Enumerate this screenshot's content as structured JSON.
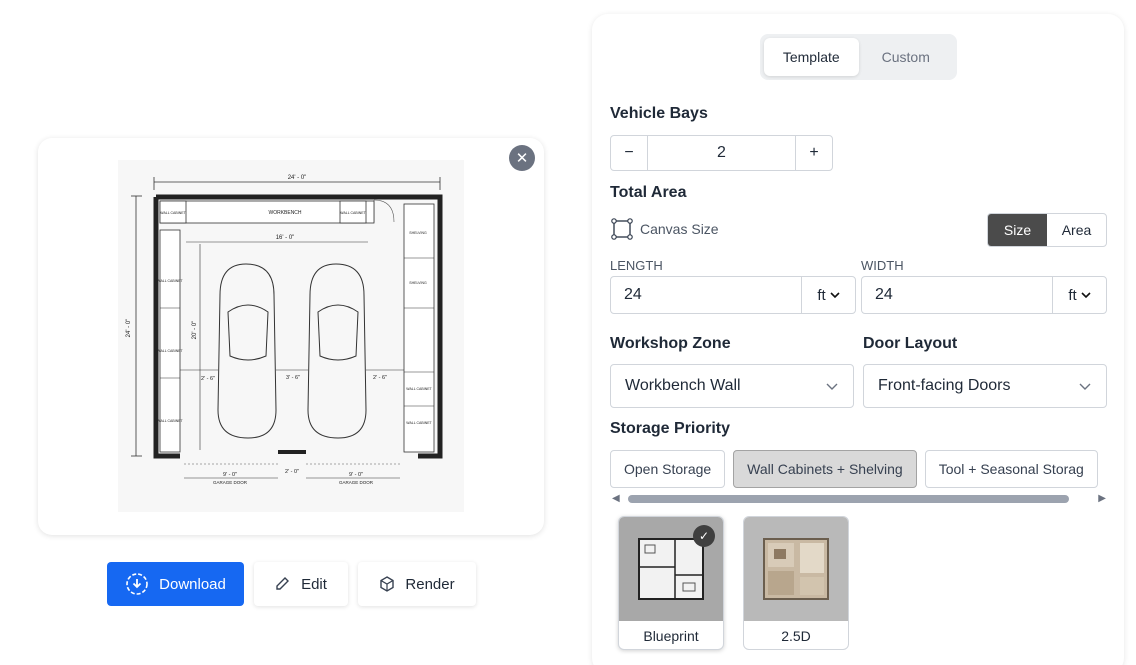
{
  "preview": {
    "close_icon": "close-icon",
    "plan": {
      "overall_width": "24' - 0\"",
      "overall_depth": "24' - 0\"",
      "workbench_length": "16' - 0\"",
      "bay_depth": "20' - 0\"",
      "dim_left": "2' - 6\"",
      "dim_center": "3' - 6\"",
      "dim_right": "2' - 6\"",
      "door_gap": "2' - 0\"",
      "door_width_left": "9' - 0\"",
      "door_width_right": "9' - 0\"",
      "label_workbench": "WORKBENCH",
      "label_wall_cabinet": "WALL CABINET",
      "label_shelving": "SHELVING",
      "label_garage_door": "GARAGE DOOR"
    }
  },
  "actions": {
    "download": "Download",
    "edit": "Edit",
    "render": "Render"
  },
  "panel": {
    "tabs": [
      "Template",
      "Custom"
    ],
    "active_tab": "Template",
    "vehicle_bays": {
      "label": "Vehicle Bays",
      "value": "2",
      "minus": "−",
      "plus": "+"
    },
    "total_area": {
      "label": "Total Area",
      "canvas_size": "Canvas Size",
      "toggle": [
        "Size",
        "Area"
      ],
      "length_label": "LENGTH",
      "length_value": "24",
      "length_unit": "ft",
      "width_label": "WIDTH",
      "width_value": "24",
      "width_unit": "ft"
    },
    "workshop_zone": {
      "label": "Workshop Zone",
      "value": "Workbench Wall"
    },
    "door_layout": {
      "label": "Door Layout",
      "value": "Front-facing Doors"
    },
    "storage_priority": {
      "label": "Storage Priority",
      "options": [
        "Open Storage",
        "Wall Cabinets + Shelving",
        "Tool + Seasonal Storag"
      ],
      "selected": "Wall Cabinets + Shelving"
    },
    "styles": [
      {
        "label": "Blueprint",
        "selected": true
      },
      {
        "label": "2.5D",
        "selected": false
      }
    ],
    "accent": "#1668f2"
  }
}
